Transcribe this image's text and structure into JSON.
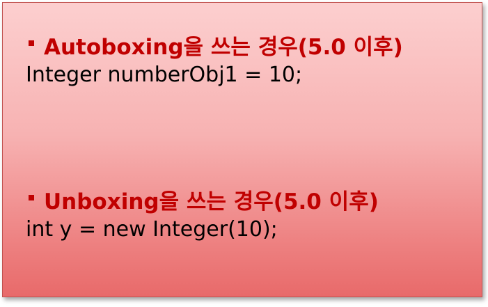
{
  "sections": [
    {
      "heading": "Autoboxing을 쓰는 경우(5.0 이후)",
      "code": "Integer numberObj1 = 10;"
    },
    {
      "heading": "Unboxing을 쓰는 경우(5.0 이후)",
      "code": "int y = new Integer(10);"
    }
  ],
  "colors": {
    "heading": "#c00000",
    "code": "#000000",
    "border": "#c0504d",
    "fill_top": "#fccfcf",
    "fill_bottom": "#e86a6a"
  },
  "icons": [
    "square-bullet-icon",
    "square-bullet-icon"
  ]
}
